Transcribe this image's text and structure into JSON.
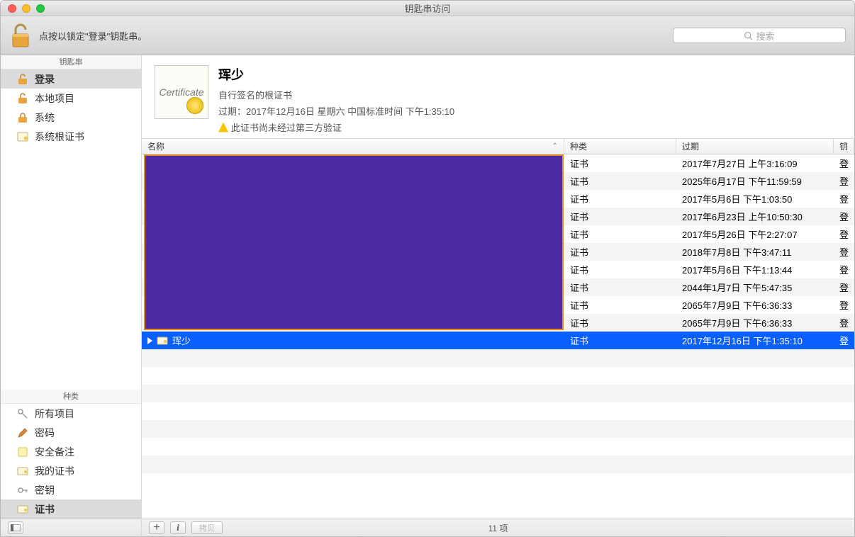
{
  "window": {
    "title": "钥匙串访问"
  },
  "toolbar": {
    "hint": "点按以锁定\"登录\"钥匙串。"
  },
  "search": {
    "placeholder": "搜索"
  },
  "sidebar": {
    "keychains_header": "钥匙串",
    "keychains": [
      {
        "label": "登录",
        "icon": "padlock-open"
      },
      {
        "label": "本地项目",
        "icon": "padlock-open"
      },
      {
        "label": "系统",
        "icon": "padlock-closed"
      },
      {
        "label": "系统根证书",
        "icon": "certificate"
      }
    ],
    "categories_header": "种类",
    "categories": [
      {
        "label": "所有项目",
        "icon": "keys"
      },
      {
        "label": "密码",
        "icon": "pencil"
      },
      {
        "label": "安全备注",
        "icon": "note"
      },
      {
        "label": "我的证书",
        "icon": "cert-small"
      },
      {
        "label": "密钥",
        "icon": "key"
      },
      {
        "label": "证书",
        "icon": "cert-small"
      }
    ]
  },
  "detail": {
    "cert_icon_text": "Certificate",
    "name": "珲少",
    "subtitle": "自行签名的根证书",
    "expires_label": "过期：",
    "expires_value": "2017年12月16日 星期六 中国标准时间 下午1:35:10",
    "warning": "此证书尚未经过第三方验证"
  },
  "columns": {
    "name": "名称",
    "kind": "种类",
    "exp": "过期",
    "keychain": "钥"
  },
  "rows": [
    {
      "kind": "证书",
      "exp": "2017年7月27日 上午3:16:09",
      "kc": "登"
    },
    {
      "kind": "证书",
      "exp": "2025年6月17日 下午11:59:59",
      "kc": "登"
    },
    {
      "kind": "证书",
      "exp": "2017年5月6日 下午1:03:50",
      "kc": "登"
    },
    {
      "kind": "证书",
      "exp": "2017年6月23日 上午10:50:30",
      "kc": "登"
    },
    {
      "kind": "证书",
      "exp": "2017年5月26日 下午2:27:07",
      "kc": "登"
    },
    {
      "kind": "证书",
      "exp": "2018年7月8日 下午3:47:11",
      "kc": "登"
    },
    {
      "kind": "证书",
      "exp": "2017年5月6日 下午1:13:44",
      "kc": "登"
    },
    {
      "kind": "证书",
      "exp": "2044年1月7日 下午5:47:35",
      "kc": "登"
    },
    {
      "kind": "证书",
      "exp": "2065年7月9日 下午6:36:33",
      "kc": "登"
    },
    {
      "kind": "证书",
      "exp": "2065年7月9日 下午6:36:33",
      "kc": "登"
    }
  ],
  "selected_row": {
    "name": "珲少",
    "kind": "证书",
    "exp": "2017年12月16日 下午1:35:10",
    "kc": "登"
  },
  "status": {
    "count": "11 项",
    "copy": "拷贝"
  }
}
